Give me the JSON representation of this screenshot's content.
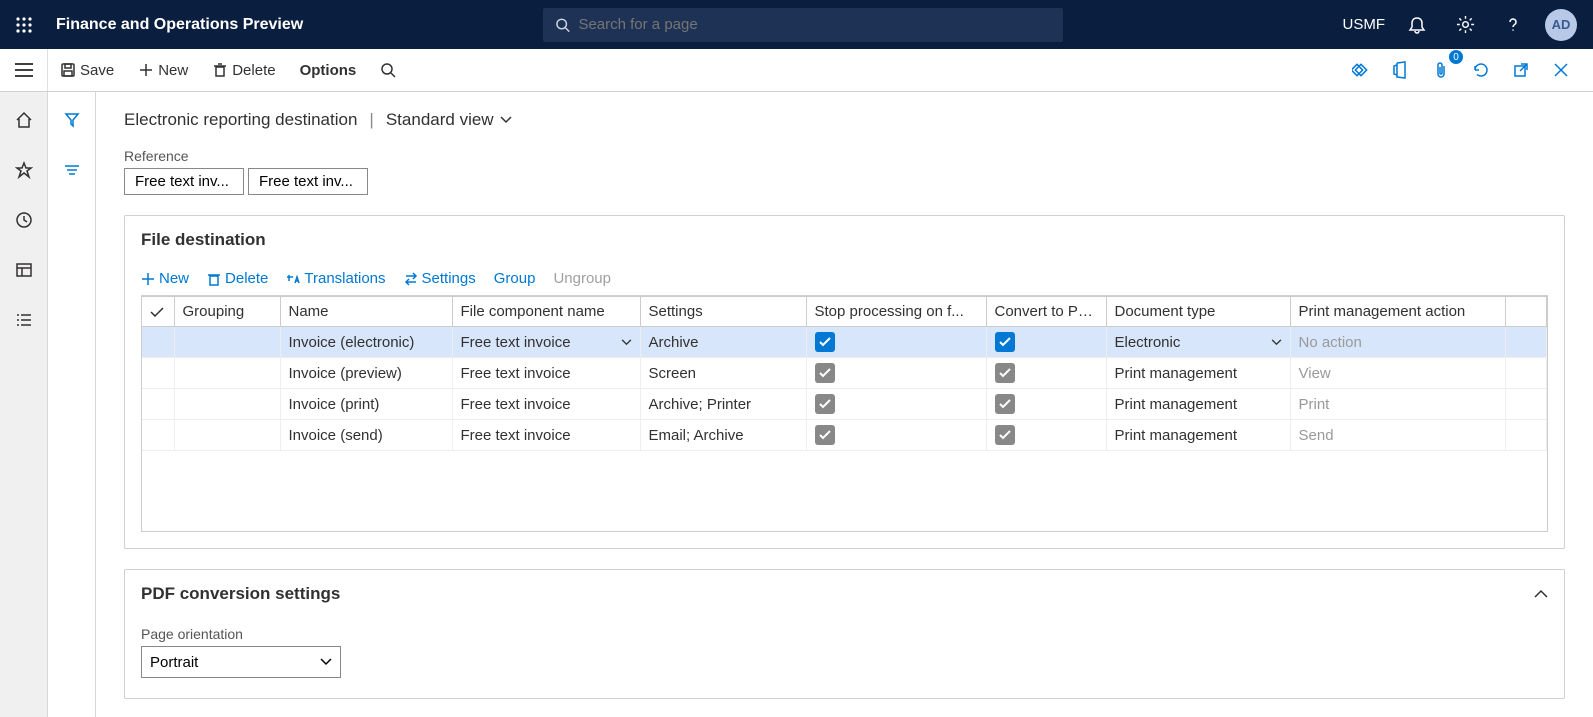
{
  "header": {
    "app_title": "Finance and Operations Preview",
    "search_placeholder": "Search for a page",
    "entity": "USMF",
    "avatar": "AD",
    "attach_count": "0"
  },
  "actions": {
    "save": "Save",
    "new": "New",
    "delete": "Delete",
    "options": "Options"
  },
  "breadcrumb": {
    "page": "Electronic reporting destination",
    "view": "Standard view"
  },
  "reference": {
    "label": "Reference",
    "box1": "Free text inv...",
    "box2": "Free text inv..."
  },
  "file_dest": {
    "title": "File destination",
    "toolbar": {
      "new": "New",
      "delete": "Delete",
      "translations": "Translations",
      "settings": "Settings",
      "group": "Group",
      "ungroup": "Ungroup"
    },
    "columns": {
      "grouping": "Grouping",
      "name": "Name",
      "file_component": "File component name",
      "settings": "Settings",
      "stop": "Stop processing on f...",
      "convert": "Convert to PDF",
      "doc_type": "Document type",
      "pm_action": "Print management action"
    },
    "rows": [
      {
        "name": "Invoice (electronic)",
        "component": "Free text invoice",
        "settings": "Archive",
        "stop": true,
        "convert": true,
        "doc_type": "Electronic",
        "pm_action": "No action",
        "selected": true,
        "pm_disabled": true
      },
      {
        "name": "Invoice (preview)",
        "component": "Free text invoice",
        "settings": "Screen",
        "stop": false,
        "convert": false,
        "doc_type": "Print management",
        "pm_action": "View",
        "selected": false,
        "pm_disabled": true
      },
      {
        "name": "Invoice (print)",
        "component": "Free text invoice",
        "settings": "Archive; Printer",
        "stop": false,
        "convert": false,
        "doc_type": "Print management",
        "pm_action": "Print",
        "selected": false,
        "pm_disabled": true
      },
      {
        "name": "Invoice (send)",
        "component": "Free text invoice",
        "settings": "Email; Archive",
        "stop": false,
        "convert": false,
        "doc_type": "Print management",
        "pm_action": "Send",
        "selected": false,
        "pm_disabled": true
      }
    ]
  },
  "pdf": {
    "title": "PDF conversion settings",
    "orientation_label": "Page orientation",
    "orientation_value": "Portrait"
  }
}
